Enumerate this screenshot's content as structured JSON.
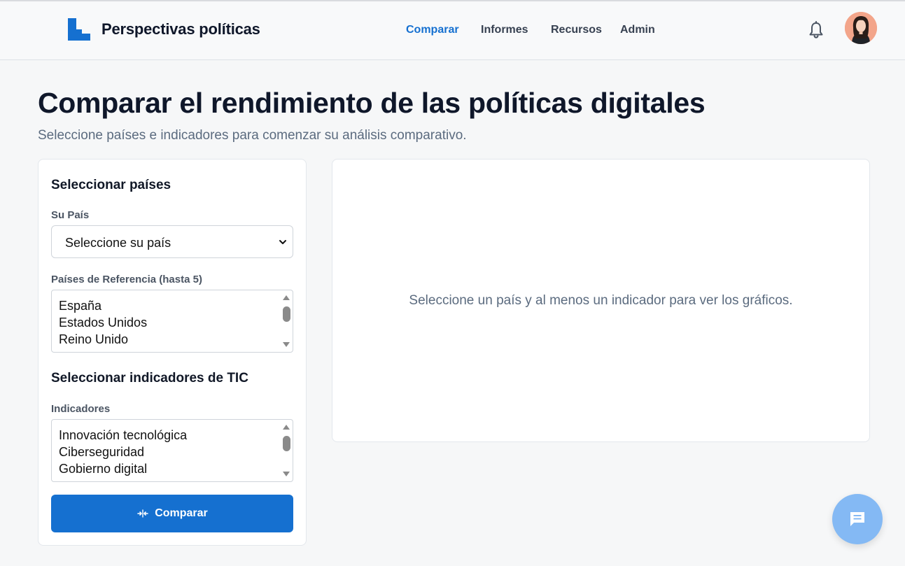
{
  "app": {
    "brand": "Perspectivas políticas",
    "logo_icon": "logo-icon"
  },
  "nav": {
    "items": [
      {
        "label": "Comparar",
        "active": true
      },
      {
        "label": "Informes",
        "active": false
      },
      {
        "label": "Recursos",
        "active": false
      },
      {
        "label": "Admin",
        "active": false
      }
    ]
  },
  "header": {
    "notifications_icon": "bell-icon",
    "avatar_icon": "user-avatar"
  },
  "page": {
    "title": "Comparar el rendimiento de las políticas digitales",
    "subtitle": "Seleccione países e indicadores para comenzar su análisis comparativo."
  },
  "countries": {
    "section_title": "Seleccionar países",
    "your_country_label": "Su País",
    "your_country_value": "Seleccione su país",
    "reference_label": "Países de Referencia (hasta 5)",
    "reference_options": [
      "España",
      "Estados Unidos",
      "Reino Unido"
    ]
  },
  "indicators": {
    "section_title": "Seleccionar indicadores de TIC",
    "label": "Indicadores",
    "options": [
      "Innovación tecnológica",
      "Ciberseguridad",
      "Gobierno digital"
    ]
  },
  "actions": {
    "compare_label": "Comparar",
    "compare_icon": "compare-arrows-icon"
  },
  "chart_panel": {
    "empty_message": "Seleccione un país y al menos un indicador para ver los gráficos."
  },
  "chat": {
    "icon": "chat-icon"
  },
  "colors": {
    "accent": "#1570d0",
    "background": "#f6f7f8",
    "fab": "#84b9f4",
    "muted_text": "#5b6b7f"
  }
}
